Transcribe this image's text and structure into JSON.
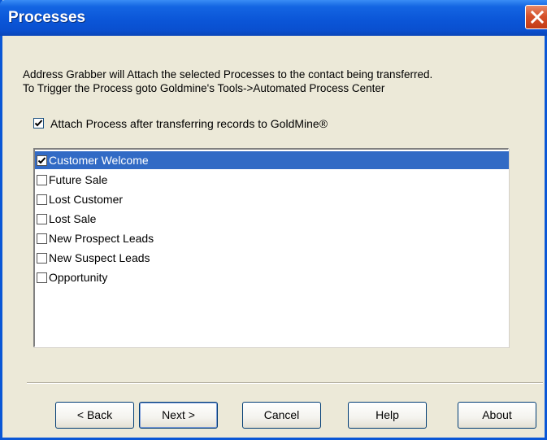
{
  "window": {
    "title": "Processes"
  },
  "instructions": {
    "line1": "Address Grabber will Attach the selected Processes to the contact being transferred.",
    "line2": "To Trigger the Process goto Goldmine's Tools->Automated Process Center"
  },
  "attach_checkbox": {
    "label": "Attach Process after transferring records to GoldMine®",
    "checked": true
  },
  "process_list": {
    "items": [
      {
        "label": "Customer Welcome",
        "checked": true,
        "selected": true
      },
      {
        "label": "Future Sale",
        "checked": false,
        "selected": false
      },
      {
        "label": "Lost Customer",
        "checked": false,
        "selected": false
      },
      {
        "label": "Lost Sale",
        "checked": false,
        "selected": false
      },
      {
        "label": "New Prospect Leads",
        "checked": false,
        "selected": false
      },
      {
        "label": "New Suspect Leads",
        "checked": false,
        "selected": false
      },
      {
        "label": "Opportunity",
        "checked": false,
        "selected": false
      }
    ]
  },
  "buttons": {
    "back": "< Back",
    "next": "Next >",
    "cancel": "Cancel",
    "help": "Help",
    "about": "About"
  },
  "colors": {
    "titlebar": "#0a56d8",
    "selection": "#316ac5",
    "dialog_bg": "#ece9d8"
  }
}
